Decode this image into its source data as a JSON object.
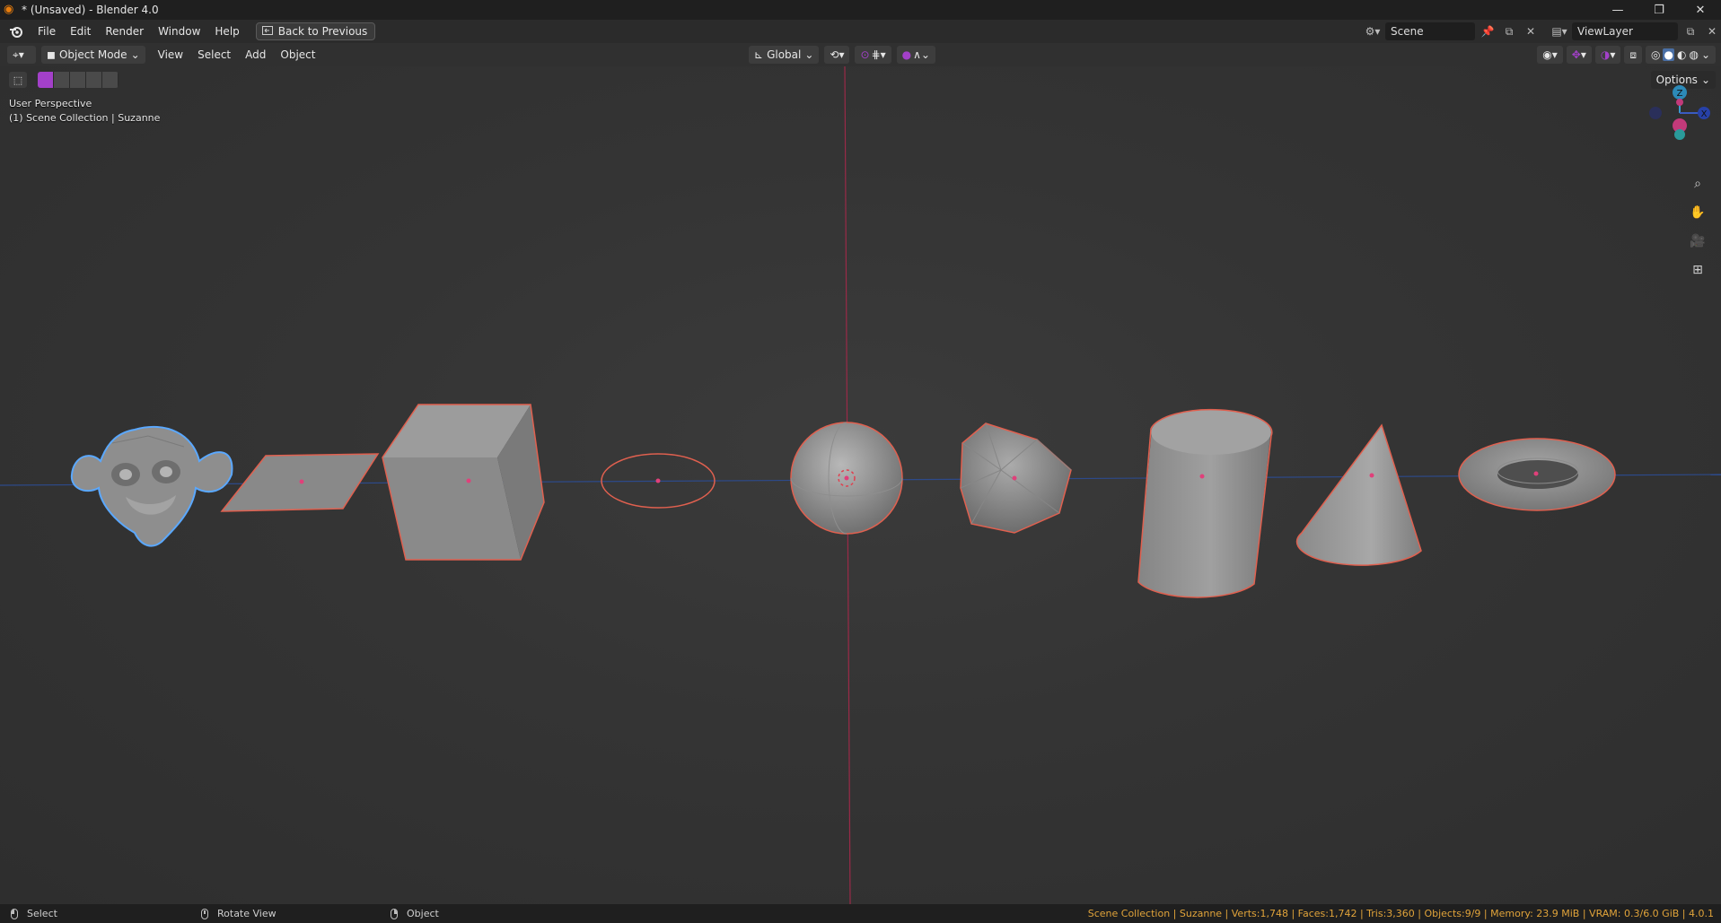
{
  "window": {
    "title": "* (Unsaved) - Blender 4.0",
    "controls": [
      "minimize-icon",
      "restore-icon",
      "close-icon"
    ]
  },
  "menubar": {
    "items": [
      "File",
      "Edit",
      "Render",
      "Window",
      "Help"
    ],
    "back_button": "Back to Previous",
    "scene_name": "Scene",
    "view_layer": "ViewLayer"
  },
  "header": {
    "mode": "Object Mode",
    "menus": [
      "View",
      "Select",
      "Add",
      "Object"
    ],
    "orientation": "Global",
    "options_label": "Options"
  },
  "viewport": {
    "perspective": "User Perspective",
    "collection_info": "(1) Scene Collection | Suzanne",
    "gizmo_axes": [
      "Z",
      "X"
    ],
    "objects": [
      "Suzanne",
      "Plane",
      "Cube",
      "Circle",
      "UV Sphere",
      "Icosphere",
      "Cylinder",
      "Cone",
      "Torus"
    ],
    "colors": {
      "selected_outline": "#e0604f",
      "active_outline": "#5aa8ff",
      "x_axis": "#c23a50",
      "y_axis": "#3a5cc2",
      "mesh_fill": "#8c8c8c",
      "accent": "#a340c9"
    }
  },
  "statusbar": {
    "select": "Select",
    "rotate": "Rotate View",
    "object": "Object",
    "stats": "Scene Collection | Suzanne | Verts:1,748 | Faces:1,742 | Tris:3,360 | Objects:9/9 | Memory: 23.9 MiB | VRAM: 0.3/6.0 GiB | 4.0.1"
  }
}
